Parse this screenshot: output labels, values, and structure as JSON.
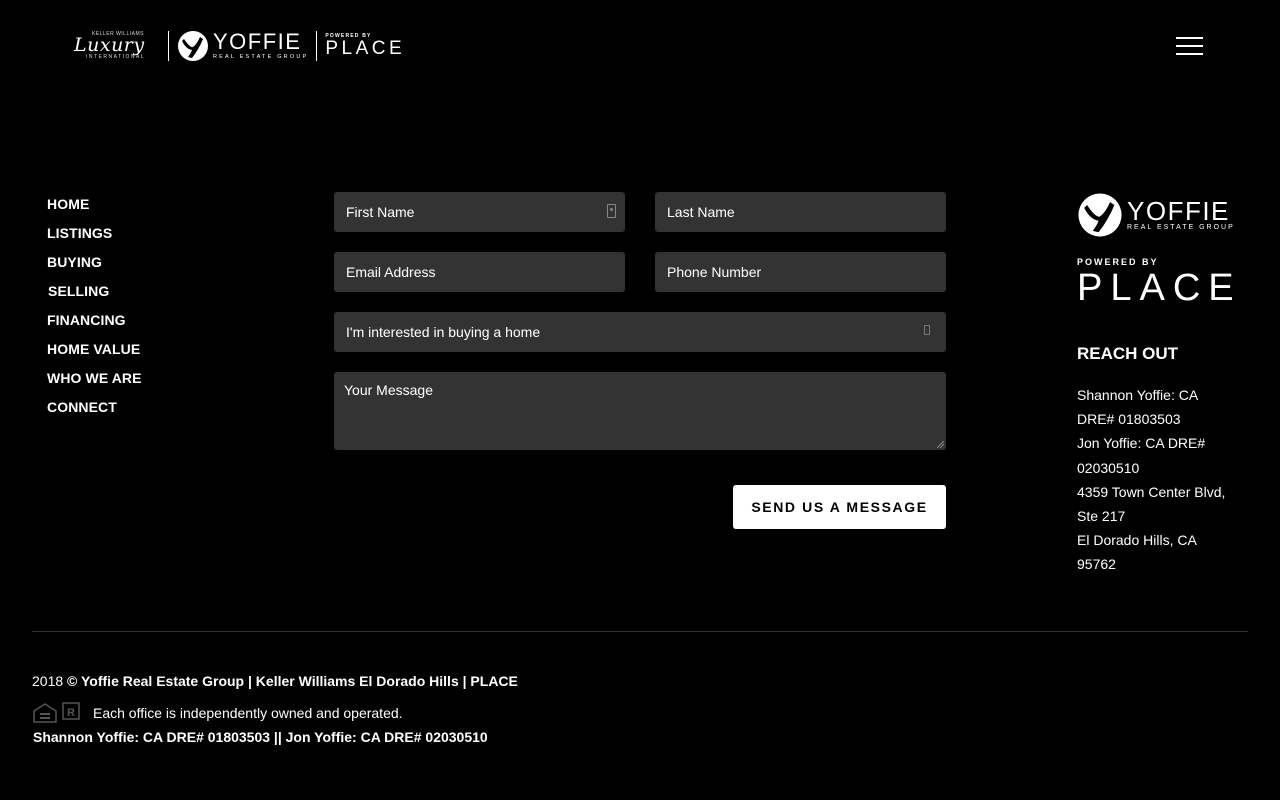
{
  "header": {
    "kw_label": "KELLER WILLIAMS",
    "luxury_label": "Luxury",
    "international_label": "INTERNATIONAL",
    "brand_name": "YOFFIE",
    "brand_sub": "REAL ESTATE GROUP",
    "powered_by": "POWERED BY",
    "place": "PLACE",
    "menu_icon": "hamburger-menu-icon"
  },
  "nav": {
    "items": [
      {
        "label": "HOME"
      },
      {
        "label": "LISTINGS"
      },
      {
        "label": "BUYING"
      },
      {
        "label": "SELLING"
      },
      {
        "label": "FINANCING"
      },
      {
        "label": "HOME VALUE"
      },
      {
        "label": "WHO WE ARE"
      },
      {
        "label": "CONNECT"
      }
    ]
  },
  "form": {
    "first_name_placeholder": "First Name",
    "last_name_placeholder": "Last Name",
    "email_placeholder": "Email Address",
    "phone_placeholder": "Phone Number",
    "interest_selected": "I'm interested in buying a home",
    "message_placeholder": "Your Message",
    "submit_label": "SEND US A MESSAGE"
  },
  "sidebar": {
    "brand_name": "YOFFIE",
    "brand_sub": "REAL ESTATE GROUP",
    "powered_by": "POWERED BY",
    "place": "PLACE",
    "heading": "REACH OUT",
    "contact_lines": [
      "Shannon Yoffie: CA",
      "DRE# 01803503",
      "Jon Yoffie: CA DRE#",
      "02030510",
      "4359 Town Center Blvd,",
      "Ste 217",
      "El Dorado Hills, CA",
      "95762"
    ]
  },
  "footer": {
    "year": "2018",
    "copyright": "© Yoffie Real Estate Group | Keller Williams El Dorado Hills | PLACE",
    "independent": "Each office is independently owned and operated.",
    "dre_line": "Shannon Yoffie: CA DRE# 01803503 || Jon Yoffie: CA DRE# 02030510",
    "icons": [
      "equal-housing-icon",
      "realtor-icon"
    ]
  },
  "colors": {
    "background": "#000000",
    "field": "#333333",
    "text": "#ffffff",
    "button_bg": "#ffffff",
    "button_text": "#000000"
  }
}
